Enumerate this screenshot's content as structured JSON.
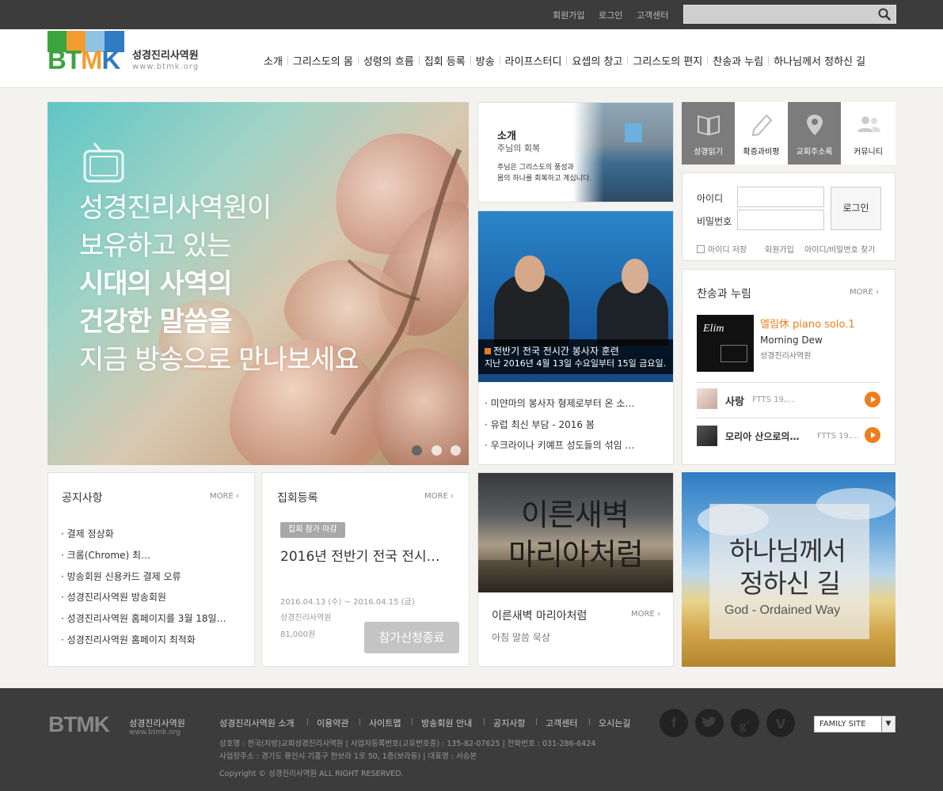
{
  "topbar": {
    "links": [
      "회원가입",
      "로그인",
      "고객센터"
    ],
    "search_placeholder": ""
  },
  "header": {
    "logo_text": "BTMK",
    "site_name": "성경진리사역원",
    "site_url": "www.btmk.org",
    "nav": [
      "소개",
      "그리스도의 몸",
      "성령의 흐름",
      "집회 등록",
      "방송",
      "라이프스터디",
      "요셉의 창고",
      "그리스도의 편지",
      "찬송과 누림",
      "하나님께서 정하신 길"
    ]
  },
  "hero": {
    "icon": "tv-icon",
    "lines": [
      "성경진리사역원이",
      "보유하고 있는",
      "시대의 사역의",
      "건강한 말씀을",
      "지금 방송으로 만나보세요"
    ],
    "slides": 3,
    "active_slide": 1
  },
  "intro": {
    "title": "소개",
    "subtitle": "주님의 회복",
    "text": [
      "주님은 그리스도의 풍성과",
      "몸의 하나를 회복하고 계십니다."
    ]
  },
  "video": {
    "caption_title": "전반기 전국 전시간 봉사자 훈련",
    "caption_text": "지난 2016년 4월 13일 수요일부터 15일 금요일…",
    "items": [
      "미얀마의 봉사자 형제로부터 온 소…",
      "유럽 최신 부담 - 2016 봄",
      "우크라이나 키예프 성도들의 섞임 …"
    ]
  },
  "quick_menu": [
    {
      "label": "성경읽기",
      "icon": "book-icon",
      "dark": true
    },
    {
      "label": "확증과비평",
      "icon": "pencil-icon",
      "dark": false
    },
    {
      "label": "교회주소록",
      "icon": "map-pin-icon",
      "dark": true
    },
    {
      "label": "커뮤니티",
      "icon": "people-icon",
      "dark": false
    }
  ],
  "login": {
    "id_label": "아이디",
    "pw_label": "비밀번호",
    "button": "로그인",
    "save_id": "아이디 저장",
    "signup": "회원가입",
    "find": "아이디/비밀번호 찾기"
  },
  "hymn": {
    "title": "찬송과 누림",
    "more": "MORE",
    "album_title": "엘림休 piano solo.1",
    "album_sub": "Morning Dew",
    "album_artist": "성경진리사역원",
    "album_cover_text": "Elim",
    "tracks": [
      {
        "title": "사랑",
        "meta": "FTTS 19,…"
      },
      {
        "title": "모리아 산으로의…",
        "meta": "FTTS 19,…"
      }
    ]
  },
  "notice": {
    "title": "공지사항",
    "more": "MORE",
    "items": [
      "결제 정상화",
      "크롬(Chrome) 최…",
      "방송회원 신용카드 결제 오류",
      "성경진리사역원 방송회원",
      "성경진리사역원 홈페이지를 3월 18일…",
      "성경진리사역원 홈페이지 최적화"
    ]
  },
  "meeting": {
    "title": "집회등록",
    "more": "MORE",
    "badge": "집회 참가 마감",
    "event_title": "2016년 전반기 전국 전시…",
    "date": "2016.04.13 (수) ~ 2016.04.15 (금)",
    "org": "성경진리사역원",
    "price": "81,000원",
    "button": "참가신청종료"
  },
  "dawn": {
    "image_text": [
      "이른새벽",
      "마리아처럼"
    ],
    "title": "이른새벽 마리아처럼",
    "more": "MORE",
    "subtitle": "아침 말씀 묵상"
  },
  "god_way": {
    "lines": [
      "하나님께서",
      "정하신 길"
    ],
    "english": "God - Ordained Way"
  },
  "footer": {
    "logo_text": "BTMK",
    "site_name": "성경진리사역원",
    "site_url": "www.btmk.org",
    "links": [
      "성경진리사역원 소개",
      "이용약관",
      "사이트맵",
      "방송회원 안내",
      "공지사항",
      "고객센터",
      "오시는길"
    ],
    "info1": "상호명 : 한국(지방)교회성경진리사역원 | 사업자등록번호(고유번호증) : 135-82-07625 | 전화번호 : 031-286-6424",
    "info2": "사업장주소 : 경기도 용인시 기흥구 한보라 1로 50, 1층(보라동) | 대표명 : 서승본",
    "copyright": "Copyright © 성경진리사역원 ALL RIGHT RESERVED.",
    "sns": [
      "facebook-icon",
      "twitter-icon",
      "google-plus-icon",
      "vimeo-icon"
    ],
    "family_site": "FAMILY SITE"
  },
  "colors": {
    "accent_orange": "#f07d1b",
    "dark_bar": "#3c3c3c",
    "logo_green": "#3aa53c",
    "logo_blue": "#2f7cc3",
    "logo_orange": "#f39c31"
  }
}
